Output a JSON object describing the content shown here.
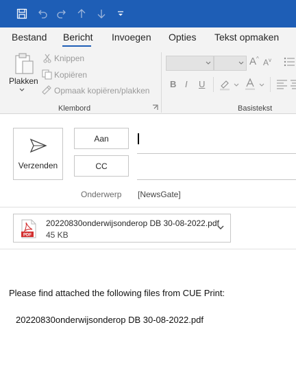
{
  "quick_access": {
    "icons": [
      "save-icon",
      "undo-icon",
      "redo-icon",
      "up-arrow-icon",
      "down-arrow-icon",
      "customize-icon"
    ]
  },
  "tabs": [
    {
      "label": "Bestand"
    },
    {
      "label": "Bericht",
      "active": true
    },
    {
      "label": "Invoegen"
    },
    {
      "label": "Opties"
    },
    {
      "label": "Tekst opmaken"
    }
  ],
  "ribbon": {
    "clipboard": {
      "paste_label": "Plakken",
      "cut_label": "Knippen",
      "copy_label": "Kopiëren",
      "format_painter_label": "Opmaak kopiëren/plakken",
      "group_label": "Klembord"
    },
    "basic_text": {
      "bold": "B",
      "italic": "I",
      "underline": "U",
      "font_size_up": "A",
      "font_size_down": "A",
      "group_label": "Basistekst"
    }
  },
  "compose": {
    "send_label": "Verzenden",
    "to_label": "Aan",
    "cc_label": "CC",
    "to_value": "",
    "cc_value": "",
    "subject_label": "Onderwerp",
    "subject_value": "[NewsGate]"
  },
  "attachment": {
    "filename": "20220830onderwijsonderop DB 30-08-2022.pdf",
    "size": "45 KB",
    "icon_label": "PDF"
  },
  "message_body": {
    "line1": "Please find attached the following files from CUE Print:",
    "line2": "20220830onderwijsonderop DB 30-08-2022.pdf"
  },
  "colors": {
    "titlebar": "#1e5eb6",
    "ribbon_bg": "#f3f3f3",
    "pdf_red": "#d32f2f",
    "active_tab_underline": "#1e5eb6"
  }
}
